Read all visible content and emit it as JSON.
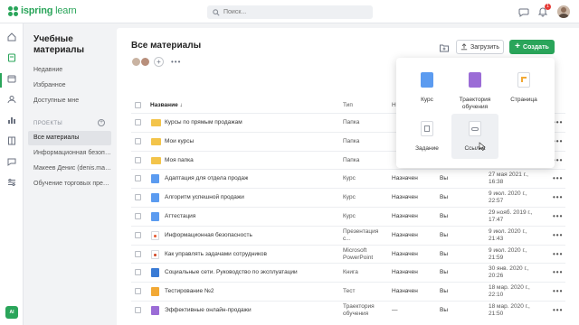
{
  "app": {
    "logo_text_bold": "ispring",
    "logo_text_light": " learn",
    "notifications_count": "1"
  },
  "search": {
    "placeholder": "Поиск..."
  },
  "rail": {
    "user_initials": "AI"
  },
  "sidebar": {
    "title": "Учебные материалы",
    "links": [
      "Недавние",
      "Избранное",
      "Доступные мне"
    ],
    "section_label": "ПРОЕКТЫ",
    "items": [
      {
        "label": "Все материалы",
        "active": true
      },
      {
        "label": "Информационная безопасн...",
        "active": false
      },
      {
        "label": "Макеев Денис (denis.mak...",
        "active": false
      },
      {
        "label": "Обучение торговых пред...",
        "active": false
      }
    ]
  },
  "main": {
    "title": "Все материалы",
    "more_label": "•••",
    "upload_label": "Загрузить",
    "create_label": "Создать"
  },
  "table": {
    "headers": {
      "name": "Название",
      "type": "Тип",
      "status": "На",
      "who": "Вы"
    },
    "rows": [
      {
        "icon": "folder",
        "name": "Курсы по прямым продажам",
        "type": "Папка",
        "status": "",
        "who": "",
        "date": ""
      },
      {
        "icon": "folder",
        "name": "Мои курсы",
        "type": "Папка",
        "status": "",
        "who": "",
        "date": ""
      },
      {
        "icon": "folder",
        "name": "Моя папка",
        "type": "Папка",
        "status": "",
        "who": "",
        "date": ""
      },
      {
        "icon": "course",
        "name": "Адаптация для отдела продаж",
        "type": "Курс",
        "status": "Назначен",
        "who": "Вы",
        "date": "27 мая 2021 г., 16:38"
      },
      {
        "icon": "course",
        "name": "Алгоритм успешной продажи",
        "type": "Курс",
        "status": "Назначен",
        "who": "Вы",
        "date": "9 июл. 2020 г., 22:57"
      },
      {
        "icon": "course",
        "name": "Аттестация",
        "type": "Курс",
        "status": "Назначен",
        "who": "Вы",
        "date": "29 нояб. 2019 г., 17:47"
      },
      {
        "icon": "pres",
        "name": "Информационная безопасность",
        "type": "Презентация с...",
        "status": "Назначен",
        "who": "Вы",
        "date": "9 июл. 2020 г., 21:43"
      },
      {
        "icon": "ppt",
        "name": "Как управлять задачами сотрудников",
        "type": "Microsoft PowerPoint",
        "status": "Назначен",
        "who": "Вы",
        "date": "9 июл. 2020 г., 21:59"
      },
      {
        "icon": "book",
        "name": "Социальные сети. Руководство по эксплуатации",
        "type": "Книга",
        "status": "Назначен",
        "who": "Вы",
        "date": "30 янв. 2020 г., 20:26"
      },
      {
        "icon": "test",
        "name": "Тестирование №2",
        "type": "Тест",
        "status": "Назначен",
        "who": "Вы",
        "date": "18 мар. 2020 г., 22:10"
      },
      {
        "icon": "track",
        "name": "Эффективные онлайн-продажи",
        "type": "Траектория обучения",
        "status": "—",
        "who": "Вы",
        "date": "18 мар. 2020 г., 21:50"
      }
    ]
  },
  "create_menu": {
    "items": [
      {
        "label": "Курс",
        "color": "#5b9bf0"
      },
      {
        "label": "Траектория обучения",
        "color": "#9b6cd6"
      },
      {
        "label": "Страница",
        "color": "#f2a935"
      },
      {
        "label": "Задание",
        "color": "#8a8f98"
      },
      {
        "label": "Ссылка",
        "color": "#8a8f98"
      }
    ]
  },
  "colors": {
    "accent": "#2aa55a",
    "badge": "#e53935"
  }
}
